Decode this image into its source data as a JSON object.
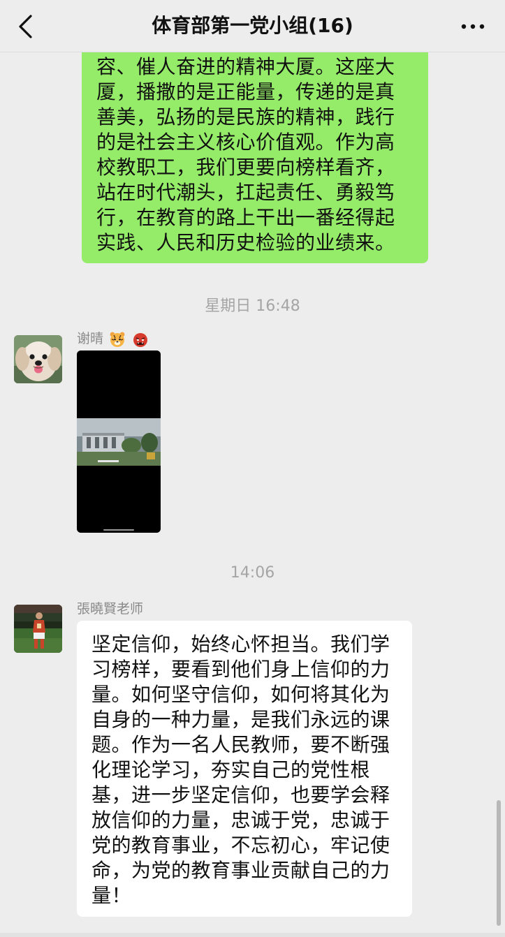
{
  "header": {
    "title": "体育部第一党小组(16)",
    "back_icon": "chevron-left-icon",
    "more_icon": "more-horizontal-icon"
  },
  "messages": [
    {
      "type": "text",
      "direction": "outgoing",
      "bubble_color": "#95ec69",
      "lines": [
        "容、催人奋进的精神大厦。这座大",
        "厦，播撒的是正能量，传递的是真",
        "善美，弘扬的是民族的精神，践行",
        "的是社会主义核心价值观。作为高",
        "校教职工，我们更要向榜样看齐，",
        "站在时代潮头，扛起责任、勇毅笃",
        "行，在教育的路上干出一番经得起",
        "实践、人民和历史检验的业绩来。"
      ]
    },
    {
      "type": "timestamp",
      "text": "星期日 16:48"
    },
    {
      "type": "video",
      "direction": "incoming",
      "sender": "谢晴",
      "sender_emojis": [
        "tiger-face-emoji",
        "ogre-mask-emoji"
      ],
      "avatar_icon": "dog-avatar"
    },
    {
      "type": "timestamp",
      "text": "14:06"
    },
    {
      "type": "text",
      "direction": "incoming",
      "sender": "張曉賢老师",
      "avatar_icon": "soccer-player-avatar",
      "bubble_color": "#ffffff",
      "lines": [
        "坚定信仰，始终心怀担当。我们学",
        "习榜样，要看到他们身上信仰的力",
        "量。如何坚守信仰，如何将其化为",
        "自身的一种力量，是我们永远的课",
        "题。作为一名人民教师，要不断强",
        "化理论学习，夯实自己的党性根",
        "基，进一步坚定信仰，也要学会释",
        "放信仰的力量，忠诚于党，忠诚于",
        "党的教育事业，不忘初心，牢记使",
        "命，为党的教育事业贡献自己的力",
        "量！"
      ]
    }
  ],
  "colors": {
    "background": "#ededed",
    "outgoing_bubble": "#95ec69",
    "incoming_bubble": "#ffffff",
    "timestamp_text": "#a5a5a5",
    "sender_text": "#8a8a8a"
  }
}
